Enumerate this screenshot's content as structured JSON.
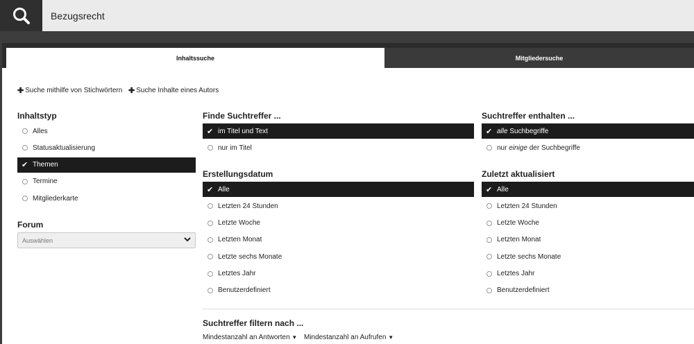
{
  "search": {
    "value": "Bezugsrecht"
  },
  "tabs": [
    {
      "label": "Inhaltssuche",
      "active": true
    },
    {
      "label": "Mitgliedersuche",
      "active": false
    }
  ],
  "links": {
    "keywords": "Suche mithilfe von Stichwörtern",
    "author": "Suche Inhalte eines Autors"
  },
  "content_type": {
    "title": "Inhaltstyp",
    "options": [
      "Alles",
      "Statusaktualisierung",
      "Themen",
      "Termine",
      "Mitgliederkarte"
    ],
    "selected": "Themen"
  },
  "forum": {
    "title": "Forum",
    "placeholder": "Auswählen"
  },
  "find_in": {
    "title": "Finde Suchtreffer ...",
    "options": [
      "im Titel und Text",
      "nur im Titel"
    ],
    "selected": "im Titel und Text"
  },
  "contains": {
    "title": "Suchtreffer enthalten ...",
    "options": [
      {
        "em": "alle",
        "rest": " Suchbegriffe"
      },
      {
        "pre": "nur ",
        "em": "einige",
        "rest": " der Suchbegriffe"
      }
    ],
    "selected_index": 0
  },
  "created": {
    "title": "Erstellungsdatum",
    "options": [
      "Alle",
      "Letzten 24 Stunden",
      "Letzte Woche",
      "Letzten Monat",
      "Letzte sechs Monate",
      "Letztes Jahr",
      "Benutzerdefiniert"
    ],
    "selected": "Alle"
  },
  "updated": {
    "title": "Zuletzt aktualisiert",
    "options": [
      "Alle",
      "Letzten 24 Stunden",
      "Letzte Woche",
      "Letzten Monat",
      "Letzte sechs Monate",
      "Letztes Jahr",
      "Benutzerdefiniert"
    ],
    "selected": "Alle"
  },
  "filter": {
    "title": "Suchtreffer filtern nach ...",
    "min_replies": "Mindestanzahl an Antworten",
    "min_views": "Mindestanzahl an Aufrufen"
  }
}
